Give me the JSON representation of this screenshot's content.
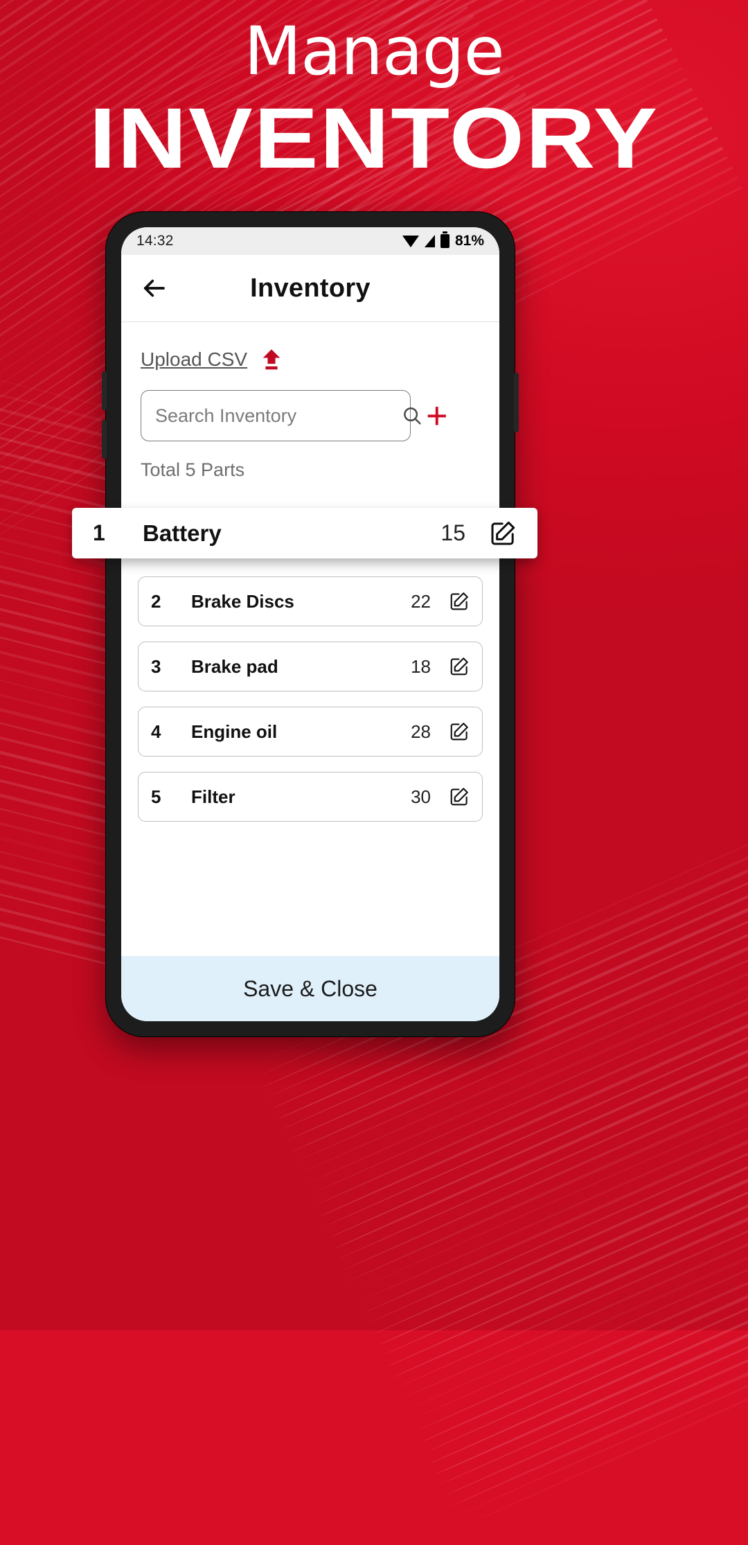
{
  "promo": {
    "headline_line1": "Manage",
    "headline_line2": "INVENTORY",
    "brand_red": "#d80d26",
    "accent_red": "#cf0a22"
  },
  "statusbar": {
    "time": "14:32",
    "battery_percent": "81%",
    "icons": [
      "wifi-icon",
      "signal-icon",
      "battery-icon"
    ]
  },
  "appbar": {
    "back_icon": "back-arrow-icon",
    "title": "Inventory"
  },
  "upload": {
    "label": "Upload CSV",
    "icon": "upload-arrow-icon"
  },
  "search": {
    "placeholder": "Search Inventory",
    "value": "",
    "icon": "search-icon",
    "add_label": "+"
  },
  "summary": {
    "total_parts": "Total 5 Parts"
  },
  "parts": [
    {
      "index": "1",
      "name": "Battery",
      "qty": "15",
      "edit_icon": "edit-icon",
      "highlighted": true
    },
    {
      "index": "2",
      "name": "Brake Discs",
      "qty": "22",
      "edit_icon": "edit-icon",
      "highlighted": false
    },
    {
      "index": "3",
      "name": "Brake pad",
      "qty": "18",
      "edit_icon": "edit-icon",
      "highlighted": false
    },
    {
      "index": "4",
      "name": "Engine oil",
      "qty": "28",
      "edit_icon": "edit-icon",
      "highlighted": false
    },
    {
      "index": "5",
      "name": "Filter",
      "qty": "30",
      "edit_icon": "edit-icon",
      "highlighted": false
    }
  ],
  "footer": {
    "save_label": "Save & Close"
  }
}
